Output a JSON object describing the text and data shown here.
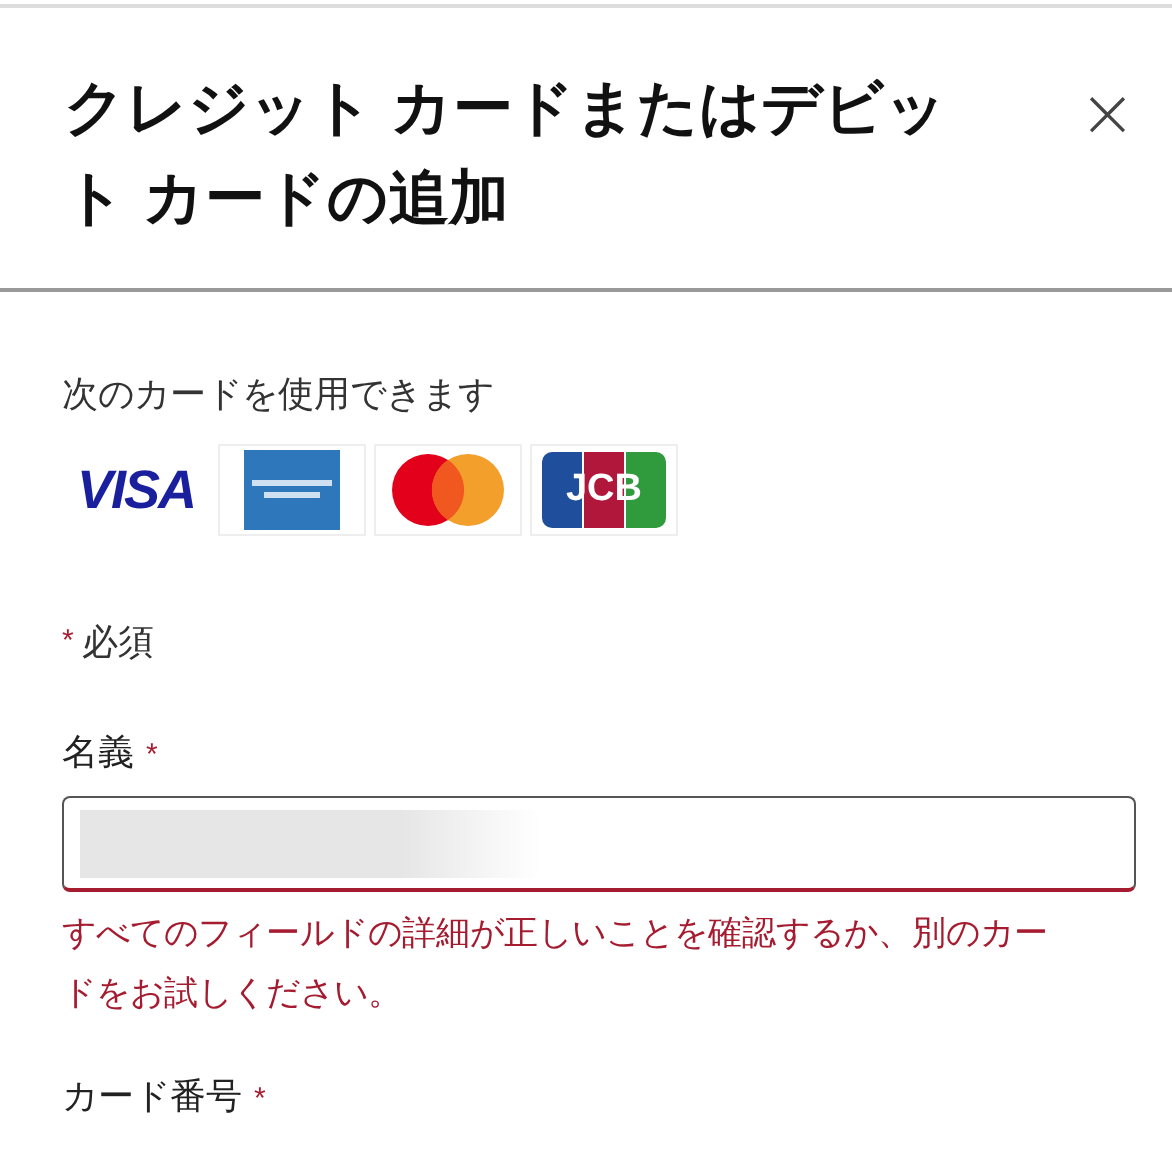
{
  "dialog": {
    "title": "クレジット カードまたはデビット カードの追加",
    "close_label": "×"
  },
  "accepted": {
    "heading": "次のカードを使用できます",
    "cards": [
      {
        "kind": "visa",
        "text": "VISA"
      },
      {
        "kind": "amex"
      },
      {
        "kind": "mastercard"
      },
      {
        "kind": "jcb",
        "text": "JCB"
      }
    ]
  },
  "legend": {
    "mark": "*",
    "text": "必須"
  },
  "fields": [
    {
      "label": "名義",
      "required_mark": "*",
      "redacted": true,
      "invalid": true,
      "error": "すべてのフィールドの詳細が正しいことを確認するか、別のカードをお試しください。"
    },
    {
      "label": "カード番号",
      "required_mark": "*"
    }
  ]
}
